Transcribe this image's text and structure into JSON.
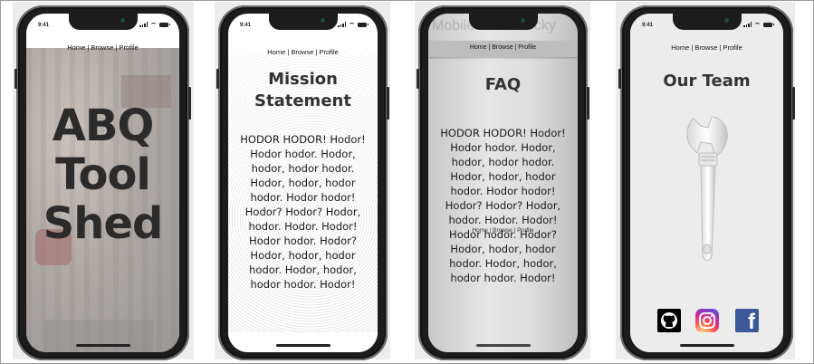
{
  "status_time": "9:41",
  "nav_text": "Home | Browse | Profile",
  "screen1": {
    "title_lines": [
      "ABQ",
      "Tool",
      "Shed"
    ]
  },
  "screen2": {
    "heading_lines": [
      "Mission",
      "Statement"
    ],
    "body_lines": [
      "HODOR HODOR! Hodor!",
      "Hodor hodor. Hodor,",
      "hodor, hodor hodor.",
      "Hodor, hodor, hodor",
      "hodor. Hodor hodor!",
      "Hodor? Hodor? Hodor,",
      "hodor. Hodor. Hodor!",
      "Hodor hodor. Hodor?",
      "Hodor, hodor, hodor",
      "hodor. Hodor, hodor,",
      "hodor hodor. Hodor!"
    ]
  },
  "screen3": {
    "ghost_text": "Mobile Nav - Sticky",
    "heading": "FAQ",
    "body_lines": [
      "HODOR HODOR! Hodor!",
      "Hodor hodor. Hodor,",
      "hodor, hodor hodor.",
      "Hodor, hodor, hodor",
      "hodor. Hodor hodor!",
      "Hodor? Hodor? Hodor,",
      "hodor. Hodor. Hodor!",
      "Hodor hodor. Hodor?",
      "Hodor, hodor, hodor",
      "hodor. Hodor, hodor,",
      "hodor hodor. Hodor!"
    ],
    "overlay_nav": "Home | Browse | Profile"
  },
  "screen4": {
    "heading": "Our Team",
    "image_icon": "wrench-icon",
    "social": [
      {
        "name": "github-icon",
        "color": "#000000"
      },
      {
        "name": "instagram-icon",
        "color": "#d6249f"
      },
      {
        "name": "facebook-icon",
        "color": "#3b5998",
        "glyph": "f"
      }
    ]
  }
}
